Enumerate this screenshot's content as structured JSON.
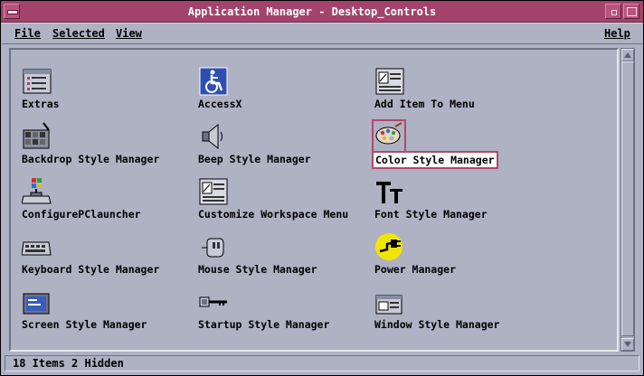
{
  "window": {
    "title": "Application Manager - Desktop_Controls"
  },
  "menubar": {
    "file": "File",
    "selected": "Selected",
    "view": "View",
    "help": "Help"
  },
  "items": [
    {
      "label": "Extras",
      "icon": "folder-list-icon"
    },
    {
      "label": "AccessX",
      "icon": "wheelchair-icon"
    },
    {
      "label": "Add Item To Menu",
      "icon": "menu-doc-icon"
    },
    {
      "label": "Backdrop Style Manager",
      "icon": "backdrop-icon"
    },
    {
      "label": "Beep Style Manager",
      "icon": "speaker-icon"
    },
    {
      "label": "Color Style Manager",
      "icon": "palette-icon"
    },
    {
      "label": "ConfigurePClauncher",
      "icon": "launcher-icon"
    },
    {
      "label": "Customize Workspace Menu",
      "icon": "menu-doc-icon"
    },
    {
      "label": "Font Style Manager",
      "icon": "font-icon"
    },
    {
      "label": "Keyboard Style Manager",
      "icon": "keyboard-icon"
    },
    {
      "label": "Mouse Style Manager",
      "icon": "mouse-icon"
    },
    {
      "label": "Power Manager",
      "icon": "power-plug-icon"
    },
    {
      "label": "Screen Style Manager",
      "icon": "screen-icon"
    },
    {
      "label": "Startup Style Manager",
      "icon": "key-icon"
    },
    {
      "label": "Window Style Manager",
      "icon": "window-icon"
    }
  ],
  "selected_item": "Color Style Manager",
  "status": {
    "text": "18 Items 2 Hidden"
  },
  "colors": {
    "titlebar": "#a3436c",
    "background": "#aeb2c3",
    "selection": "#b3476f"
  }
}
